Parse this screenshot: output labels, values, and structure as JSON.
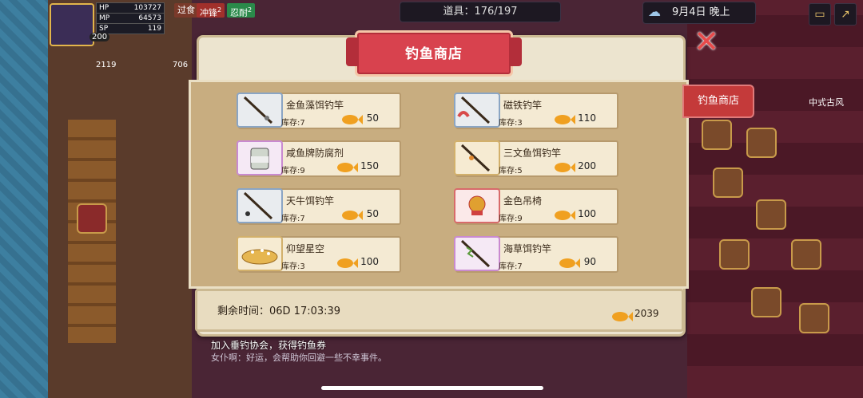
{
  "hud": {
    "hp_label": "HP",
    "hp_value": "103727",
    "mp_label": "MP",
    "mp_value": "64573",
    "sp_label": "SP",
    "sp_value": "119",
    "level": "200",
    "count_left": "2119",
    "count_right": "706",
    "chip_pass": "过食",
    "chip_charge": "冲锋",
    "chip_charge_badge": "2",
    "chip_tolerance": "忍耐",
    "chip_tolerance_badge": "2",
    "items_counter": "道具：176/197",
    "date_text": "9月4日 晚上"
  },
  "side_tab": {
    "label": "钓鱼商店"
  },
  "right_labels": {
    "area": "中式古风"
  },
  "shop": {
    "title": "钓鱼商店",
    "items": [
      {
        "name": "金鱼藻饵钓竿",
        "stock": "库存:7",
        "price": "50"
      },
      {
        "name": "磁铁钓竿",
        "stock": "库存:3",
        "price": "110"
      },
      {
        "name": "咸鱼牌防腐剂",
        "stock": "库存:9",
        "price": "150"
      },
      {
        "name": "三文鱼饵钓竿",
        "stock": "库存:5",
        "price": "200"
      },
      {
        "name": "天牛饵钓竿",
        "stock": "库存:7",
        "price": "50"
      },
      {
        "name": "金色吊椅",
        "stock": "库存:9",
        "price": "100"
      },
      {
        "name": "仰望星空",
        "stock": "库存:3",
        "price": "100"
      },
      {
        "name": "海草饵钓竿",
        "stock": "库存:7",
        "price": "90"
      }
    ],
    "icon_names": [
      "rod-blue-icon",
      "magnet-rod-icon",
      "preservative-jar-icon",
      "salmon-rod-icon",
      "beetle-rod-icon",
      "golden-swing-icon",
      "starry-cake-icon",
      "seaweed-rod-icon"
    ],
    "remaining_time": "剩余时间：06D 17:03:39",
    "balance": "2039"
  },
  "info": {
    "line1": "加入垂钓协会，获得钓鱼券",
    "line2": "女仆啊：好运，会帮助你回避一些不幸事件。"
  },
  "colors": {
    "banner": "#d8424e",
    "panel": "#ece4cf",
    "inner": "#c8ad80",
    "close": "#e84a4a"
  }
}
